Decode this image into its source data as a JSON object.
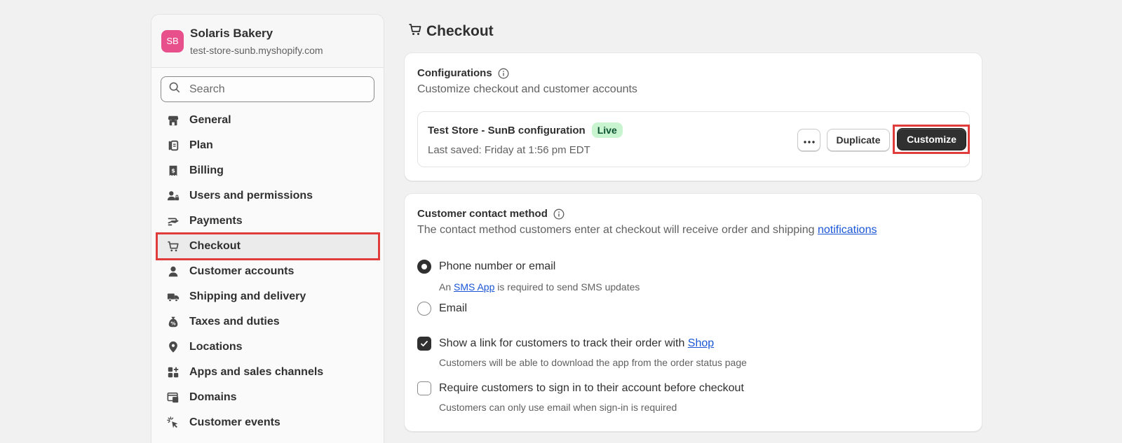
{
  "store": {
    "initials": "SB",
    "name": "Solaris Bakery",
    "url": "test-store-sunb.myshopify.com",
    "avatar_color": "#e8508b"
  },
  "search": {
    "placeholder": "Search",
    "value": ""
  },
  "nav": [
    {
      "label": "General",
      "icon": "store-icon"
    },
    {
      "label": "Plan",
      "icon": "plan-icon"
    },
    {
      "label": "Billing",
      "icon": "receipt-dollar-icon"
    },
    {
      "label": "Users and permissions",
      "icon": "users-lock-icon"
    },
    {
      "label": "Payments",
      "icon": "payments-hand-icon"
    },
    {
      "label": "Checkout",
      "icon": "cart-icon",
      "active": true
    },
    {
      "label": "Customer accounts",
      "icon": "person-icon"
    },
    {
      "label": "Shipping and delivery",
      "icon": "truck-icon"
    },
    {
      "label": "Taxes and duties",
      "icon": "tax-bag-icon"
    },
    {
      "label": "Locations",
      "icon": "location-pin-icon"
    },
    {
      "label": "Apps and sales channels",
      "icon": "apps-icon"
    },
    {
      "label": "Domains",
      "icon": "domains-icon"
    },
    {
      "label": "Customer events",
      "icon": "cursor-click-icon"
    }
  ],
  "page": {
    "title": "Checkout"
  },
  "configurations": {
    "title": "Configurations",
    "subtitle": "Customize checkout and customer accounts",
    "config_name": "Test Store - SunB configuration",
    "badge": "Live",
    "last_saved": "Last saved: Friday at 1:56 pm EDT",
    "more_label": "•••",
    "duplicate_label": "Duplicate",
    "customize_label": "Customize"
  },
  "contact": {
    "title": "Customer contact method",
    "desc_prefix": "The contact method customers enter at checkout will receive order and shipping ",
    "desc_link": "notifications",
    "options": {
      "phone_or_email": "Phone number or email",
      "sms_prefix": "An ",
      "sms_link": "SMS App",
      "sms_suffix": " is required to send SMS updates",
      "email": "Email"
    },
    "selected": "phone_or_email",
    "track_link_prefix": "Show a link for customers to track their order with ",
    "track_link_link": "Shop",
    "track_help": "Customers will be able to download the app from the order status page",
    "track_checked": true,
    "signin_label": "Require customers to sign in to their account before checkout",
    "signin_help": "Customers can only use email when sign-in is required",
    "signin_checked": false
  },
  "colors": {
    "accent_dark": "#303030",
    "link": "#1a56d6",
    "live_badge_bg": "#c8f5d0",
    "highlight": "#e03c3c"
  }
}
